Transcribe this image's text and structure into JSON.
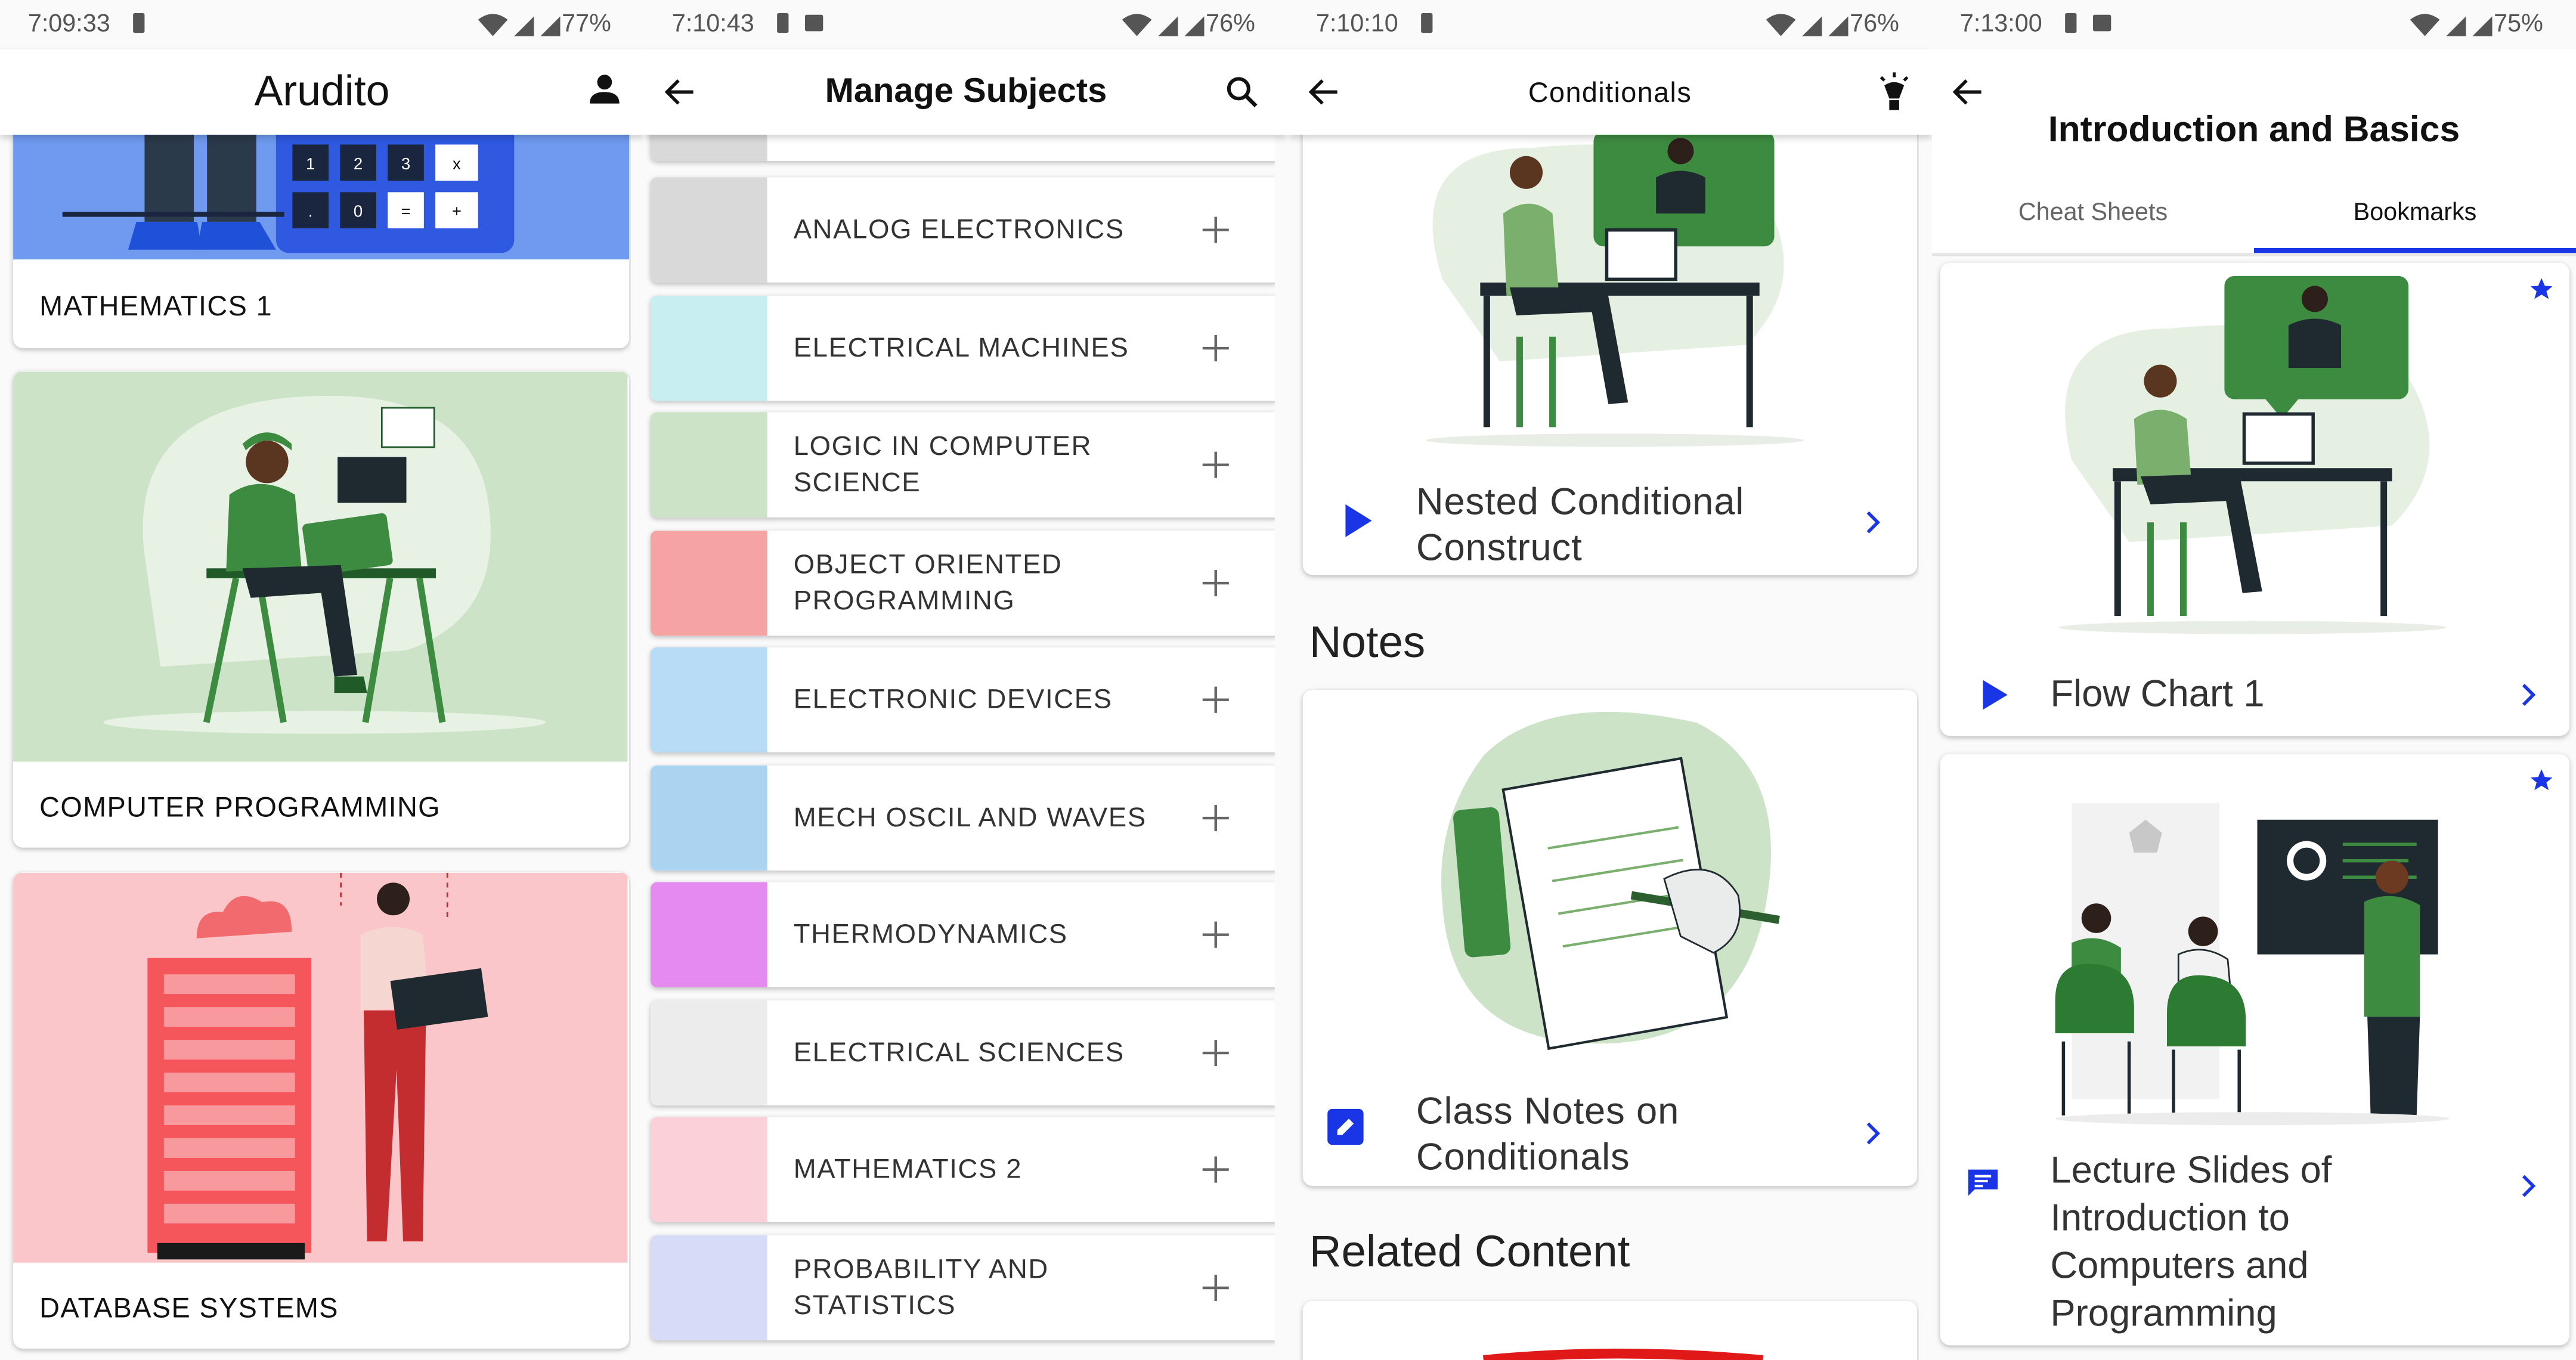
{
  "colors": {
    "accent_green": "#3d8b40",
    "light_green": "#cde3c7",
    "pink_bg": "#fbc6c9",
    "blue_bg": "#6f9af0",
    "play_blue": "#1a35e6",
    "tab_underline": "#1a35e6"
  },
  "panel1": {
    "status": {
      "time": "7:09:33",
      "battery": "77%"
    },
    "app_title": "Arudito",
    "subjects": [
      {
        "label": "MATHEMATICS 1",
        "keypad": [
          "1",
          "2",
          "3",
          "x",
          ".",
          "0",
          "=",
          "+"
        ]
      },
      {
        "label": "COMPUTER PROGRAMMING"
      },
      {
        "label": "DATABASE SYSTEMS"
      }
    ]
  },
  "panel2": {
    "status": {
      "time": "7:10:43",
      "battery": "76%"
    },
    "title": "Manage Subjects",
    "items": [
      {
        "label": "ANALOG ELECTRONICS",
        "thumb_color": "#d9d9d9"
      },
      {
        "label": "ELECTRICAL MACHINES",
        "thumb_color": "#c8eef2"
      },
      {
        "label": "LOGIC IN COMPUTER SCIENCE",
        "thumb_color": "#cde3c7"
      },
      {
        "label": "OBJECT ORIENTED PROGRAMMING",
        "thumb_color": "#f6a3a3"
      },
      {
        "label": "ELECTRONIC DEVICES",
        "thumb_color": "#b8dcf5"
      },
      {
        "label": "MECH OSCIL AND WAVES",
        "thumb_color": "#aad4f0"
      },
      {
        "label": "THERMODYNAMICS",
        "thumb_color": "#e58af0"
      },
      {
        "label": "ELECTRICAL SCIENCES",
        "thumb_color": "#ececec"
      },
      {
        "label": "MATHEMATICS 2",
        "thumb_color": "#fbd0d8"
      },
      {
        "label": "PROBABILITY AND STATISTICS",
        "thumb_color": "#d6dcf7"
      }
    ]
  },
  "panel3": {
    "status": {
      "time": "7:10:10",
      "battery": "76%"
    },
    "title": "Conditionals",
    "video_title": "Nested Conditional Construct",
    "notes_heading": "Notes",
    "note_title": "Class Notes on Conditionals",
    "related_heading": "Related Content"
  },
  "panel4": {
    "status": {
      "time": "7:13:00",
      "battery": "75%"
    },
    "title": "Introduction and Basics",
    "tabs": [
      "Cheat Sheets",
      "Bookmarks"
    ],
    "active_tab": "Bookmarks",
    "bookmarks": [
      {
        "title": "Flow Chart 1",
        "type": "video"
      },
      {
        "title": "Lecture Slides of Introduction to Computers and Programming",
        "type": "slides"
      }
    ]
  }
}
